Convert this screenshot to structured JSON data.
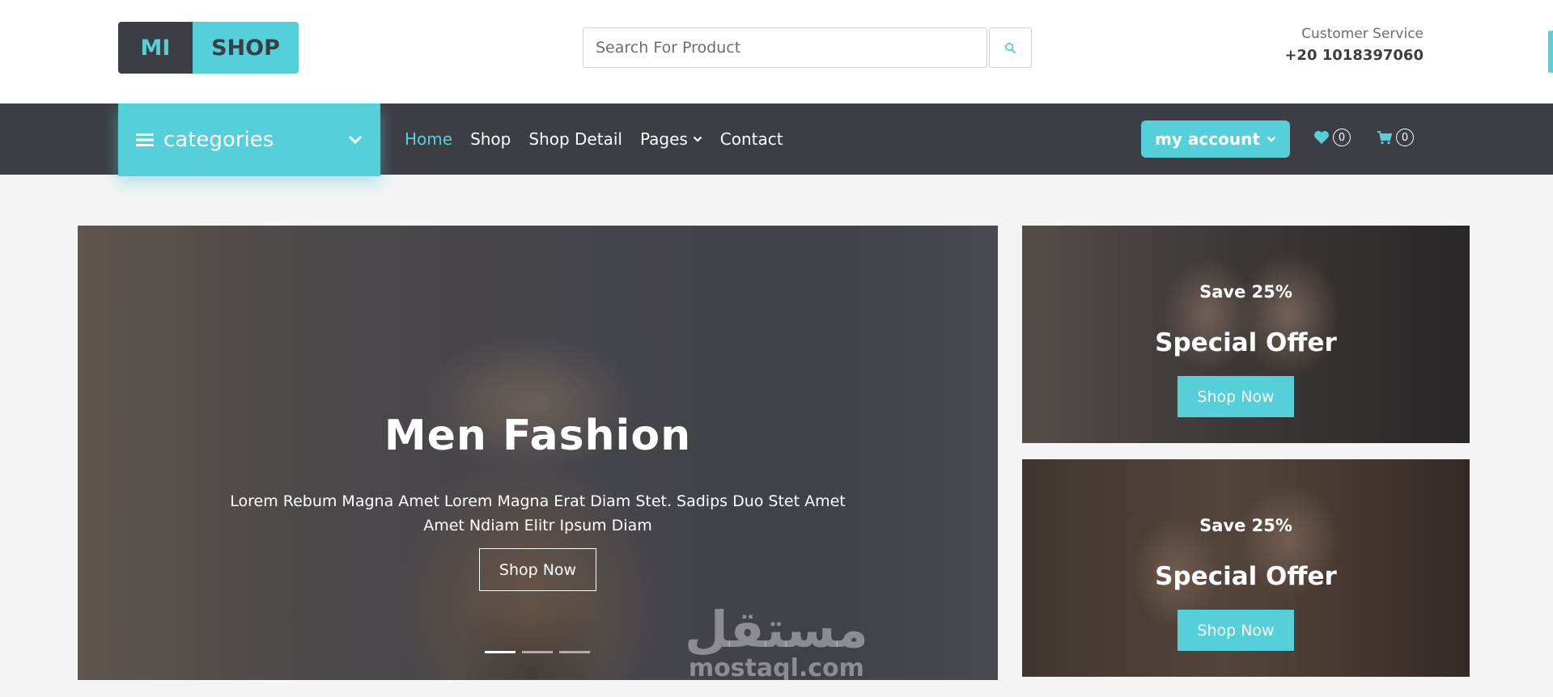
{
  "brand": {
    "part1": "MI",
    "part2": "SHOP"
  },
  "search": {
    "placeholder": "Search For Product"
  },
  "customer_service": {
    "label": "Customer Service",
    "phone": "+20 1018397060"
  },
  "nav": {
    "categories_label": "categories",
    "menu": [
      {
        "label": "Home",
        "active": true
      },
      {
        "label": "Shop"
      },
      {
        "label": "Shop Detail"
      },
      {
        "label": "Pages",
        "has_dropdown": true
      },
      {
        "label": "Contact"
      }
    ],
    "account_label": "my account",
    "wishlist_count": "0",
    "cart_count": "0"
  },
  "hero": {
    "title": "Men Fashion",
    "description": "Lorem Rebum Magna Amet Lorem Magna Erat Diam Stet. Sadips Duo Stet Amet Amet Ndiam Elitr Ipsum Diam",
    "button": "Shop Now",
    "slides_total": 3,
    "active_slide": 1
  },
  "offers": [
    {
      "save": "Save 25%",
      "title": "Special Offer",
      "button": "Shop Now"
    },
    {
      "save": "Save 25%",
      "title": "Special Offer",
      "button": "Shop Now"
    }
  ],
  "watermark": {
    "arabic": "مستقل",
    "latin": "mostaql.com"
  },
  "colors": {
    "accent": "#55d0db",
    "dark": "#3d3e44",
    "background": "#f4f4f4"
  },
  "icons": [
    "search-icon",
    "bars-icon",
    "chevron-down-icon",
    "heart-icon",
    "cart-icon"
  ]
}
